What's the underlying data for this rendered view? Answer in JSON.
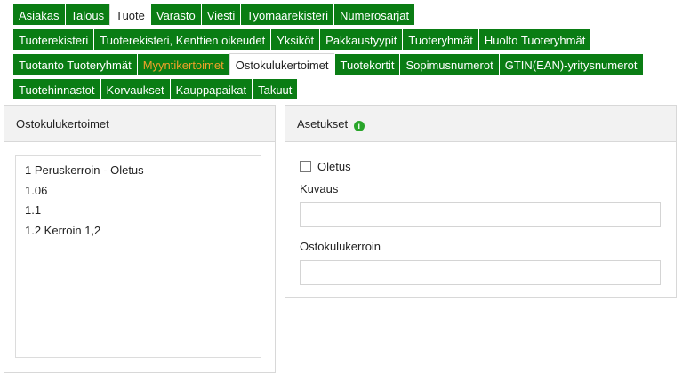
{
  "nav": {
    "rows": [
      [
        {
          "label": "Asiakas",
          "state": "normal"
        },
        {
          "label": "Talous",
          "state": "normal"
        },
        {
          "label": "Tuote",
          "state": "active"
        },
        {
          "label": "Varasto",
          "state": "normal"
        },
        {
          "label": "Viesti",
          "state": "normal"
        },
        {
          "label": "Työmaarekisteri",
          "state": "normal"
        },
        {
          "label": "Numerosarjat",
          "state": "normal"
        }
      ],
      [
        {
          "label": "Tuoterekisteri",
          "state": "normal"
        },
        {
          "label": "Tuoterekisteri, Kenttien oikeudet",
          "state": "normal"
        },
        {
          "label": "Yksiköt",
          "state": "normal"
        },
        {
          "label": "Pakkaustyypit",
          "state": "normal"
        },
        {
          "label": "Tuoteryhmät",
          "state": "normal"
        },
        {
          "label": "Huolto Tuoteryhmät",
          "state": "normal"
        }
      ],
      [
        {
          "label": "Tuotanto Tuoteryhmät",
          "state": "normal"
        },
        {
          "label": "Myyntikertoimet",
          "state": "highlight"
        },
        {
          "label": "Ostokulukertoimet",
          "state": "active"
        },
        {
          "label": "Tuotekortit",
          "state": "normal"
        },
        {
          "label": "Sopimusnumerot",
          "state": "normal"
        },
        {
          "label": "GTIN(EAN)-yritysnumerot",
          "state": "normal"
        }
      ],
      [
        {
          "label": "Tuotehinnastot",
          "state": "normal"
        },
        {
          "label": "Korvaukset",
          "state": "normal"
        },
        {
          "label": "Kauppapaikat",
          "state": "normal"
        },
        {
          "label": "Takuut",
          "state": "normal"
        }
      ]
    ]
  },
  "left_panel": {
    "title": "Ostokulukertoimet",
    "items": [
      "1 Peruskerroin - Oletus",
      "1.06",
      "1.1",
      "1.2 Kerroin 1,2"
    ]
  },
  "right_panel": {
    "title": "Asetukset",
    "info_icon_glyph": "i",
    "default_label": "Oletus",
    "default_checked": false,
    "description_label": "Kuvaus",
    "description_value": "",
    "multiplier_label": "Ostokulukerroin",
    "multiplier_value": ""
  },
  "colors": {
    "tab_green": "#0a7d14",
    "highlight_orange": "#f0a12a",
    "info_green": "#29a52a"
  }
}
